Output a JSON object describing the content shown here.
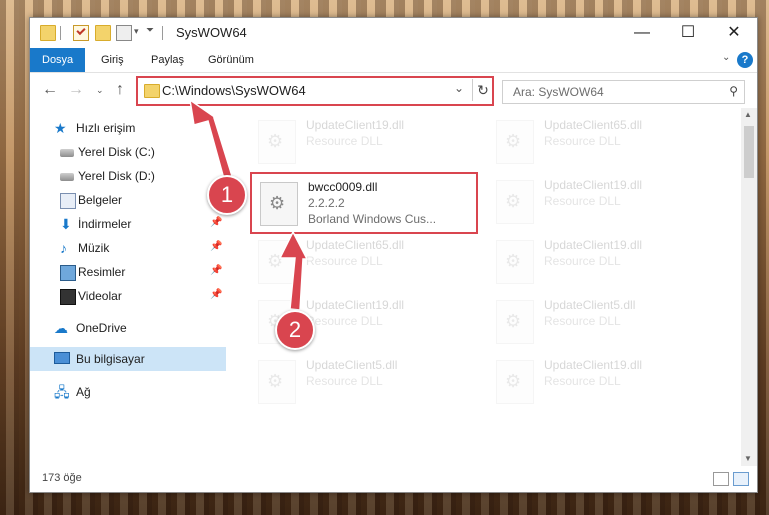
{
  "window": {
    "title": "SysWOW64",
    "minimize": "—",
    "maximize": "☐",
    "close": "✕"
  },
  "ribbon": {
    "tabs": [
      "Dosya",
      "Giriş",
      "Paylaş",
      "Görünüm"
    ],
    "help": "?"
  },
  "address": {
    "path": "C:\\Windows\\SysWOW64",
    "search_placeholder": "Ara: SysWOW64"
  },
  "sidebar": {
    "items": [
      {
        "label": "Hızlı erişim",
        "icon": "star-icon"
      },
      {
        "label": "Yerel Disk (C:)",
        "icon": "drive-icon"
      },
      {
        "label": "Yerel Disk (D:)",
        "icon": "drive-icon"
      },
      {
        "label": "Belgeler",
        "icon": "documents-icon"
      },
      {
        "label": "İndirmeler",
        "icon": "download-icon"
      },
      {
        "label": "Müzik",
        "icon": "music-icon"
      },
      {
        "label": "Resimler",
        "icon": "pictures-icon"
      },
      {
        "label": "Videolar",
        "icon": "videos-icon"
      },
      {
        "label": "OneDrive",
        "icon": "cloud-icon"
      },
      {
        "label": "Bu bilgisayar",
        "icon": "computer-icon"
      },
      {
        "label": "Ağ",
        "icon": "network-icon"
      }
    ]
  },
  "files": {
    "highlighted": {
      "name": "bwcc0009.dll",
      "version": "2.2.2.2",
      "description": "Borland Windows Cus..."
    },
    "faded": [
      {
        "name": "UpdateClient19.dll",
        "type": "Resource DLL"
      },
      {
        "name": "UpdateClient65.dll",
        "type": "Resource DLL"
      },
      {
        "name": "UpdateClient19.dll",
        "type": "Resource DLL"
      },
      {
        "name": "UpdateClient65.dll",
        "type": "Resource DLL"
      },
      {
        "name": "UpdateClient19.dll",
        "type": "Resource DLL"
      },
      {
        "name": "UpdateClient19.dll",
        "type": "Resource DLL"
      },
      {
        "name": "UpdateClient5.dll",
        "type": "Resource DLL"
      },
      {
        "name": "UpdateClient5.dll",
        "type": "Resource DLL"
      },
      {
        "name": "UpdateClient19.dll",
        "type": "Resource DLL"
      }
    ]
  },
  "status": {
    "count": "173 öğe"
  },
  "annotations": {
    "step1": "1",
    "step2": "2",
    "color": "#d9454f"
  }
}
